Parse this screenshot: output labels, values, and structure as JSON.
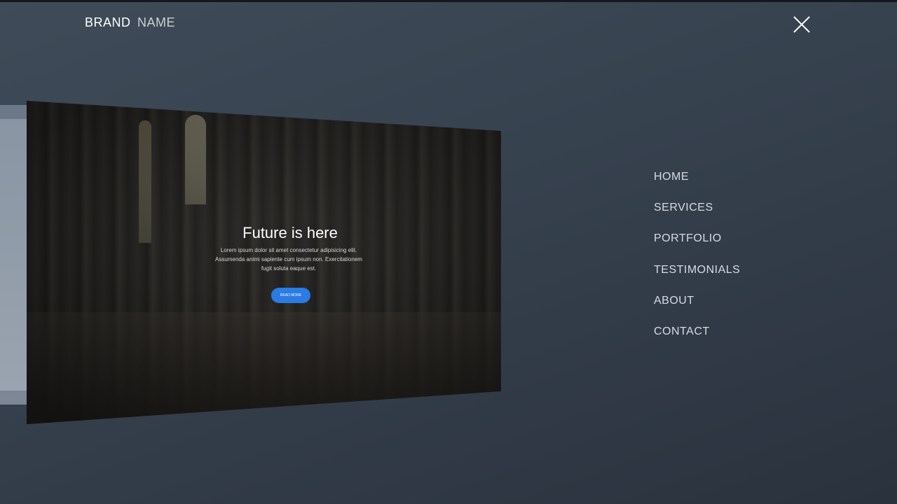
{
  "header": {
    "brand_primary": "BRAND",
    "brand_secondary": "NAME",
    "close_icon": "close-icon"
  },
  "preview": {
    "title": "Future is here",
    "text": "Lorem ipsum dolor sit amet consectetur adipisicing elit. Assumenda animi sapiente cum ipsum non. Exercitationem fugit soluta eaque est.",
    "button_label": "READ MORE",
    "accent": "#2a7be4"
  },
  "menu": {
    "items": [
      {
        "label": "HOME"
      },
      {
        "label": "SERVICES"
      },
      {
        "label": "PORTFOLIO"
      },
      {
        "label": "TESTIMONIALS"
      },
      {
        "label": "ABOUT"
      },
      {
        "label": "CONTACT"
      }
    ]
  },
  "colors": {
    "background": "#36414e",
    "menu_text": "#d6dbe1"
  }
}
